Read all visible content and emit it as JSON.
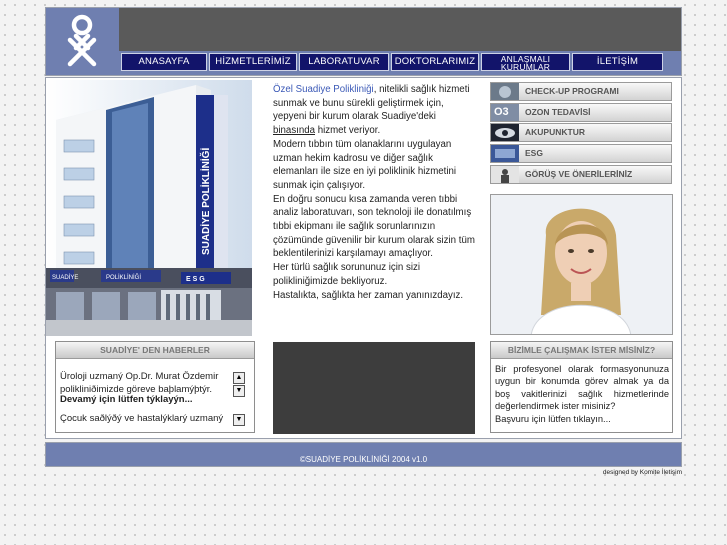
{
  "nav": {
    "items": [
      "ANASAYFA",
      "HİZMETLERİMİZ",
      "LABORATUVAR",
      "DOKTORLARIMIZ",
      "ANLAŞMALI",
      "KURUMLAR",
      "İLETİŞİM"
    ]
  },
  "building": {
    "sign_vertical": "SUADİYE POLİKLİNİĞİ",
    "sign_left": "SUADİYE",
    "sign_right": "POLİKLİNİĞİ",
    "sign_esg": "E S G"
  },
  "intro": {
    "p1_highlight": "Özel Suadiye Polikliniği",
    "p1": ", nitelikli sağlık hizmeti sunmak ve bunu sürekli geliştirmek için, yepyeni bir kurum olarak Suadiye'deki ",
    "p1_link": "binasında",
    "p1_end": " hizmet veriyor.",
    "p2": "Modern tıbbın tüm olanaklarını uygulayan uzman hekim kadrosu ve diğer sağlık elemanları ile size en iyi poliklinik hizmetini sunmak için çalışıyor.",
    "p3": "En doğru sonucu kısa zamanda veren tıbbi analiz laboratuvarı, son teknoloji ile donatılmış tıbbi ekipmanı ile sağlık sorunlarınızın çözümünde güvenilir bir kurum olarak sizin tüm beklentilerinizi karşılamayı amaçlıyor.",
    "p4": "Her türlü sağlık sorununuz için sizi polikliniğimizde bekliyoruz.",
    "p5": "Hastalıkta, sağlıkta her zaman yanınızdayız."
  },
  "menu": {
    "items": [
      "CHECK-UP PROGRAMI",
      "OZON TEDAVİSİ",
      "AKUPUNKTUR",
      "ESG",
      "GÖRÜŞ VE ÖNERİLERİNİZ"
    ],
    "ozon_badge": "O3"
  },
  "news": {
    "title": "SUADİYE' DEN HABERLER",
    "item1": "Üroloji uzmaný Op.Dr. Murat Özdemir polikliniðimizde göreve baþlamýþtýr.",
    "item1_link": "Devamý için lütfen týklayýn...",
    "item2": "Çocuk saðlýðý ve hastalýklarý uzmaný"
  },
  "career": {
    "title": "BİZİMLE ÇALIŞMAK İSTER MİSİNİZ?",
    "text": "Bir profesyonel olarak formasyonunuza uygun bir konumda görev almak ya da boş vakitlerinizi sağlık hizmetlerinde değerlendirmek ister misiniz?",
    "link": "Başvuru için lütfen tıklayın..."
  },
  "footer": {
    "copyright": "©SUADİYE POLİKLİNİĞİ 2004 v1.0",
    "designed": "designed by Komite İletişim"
  },
  "colors": {
    "nav_bg": "#12146a",
    "band_blue": "#6f7fb0",
    "header_gray": "#5a5a5a",
    "link_blue": "#3c5ab7"
  }
}
